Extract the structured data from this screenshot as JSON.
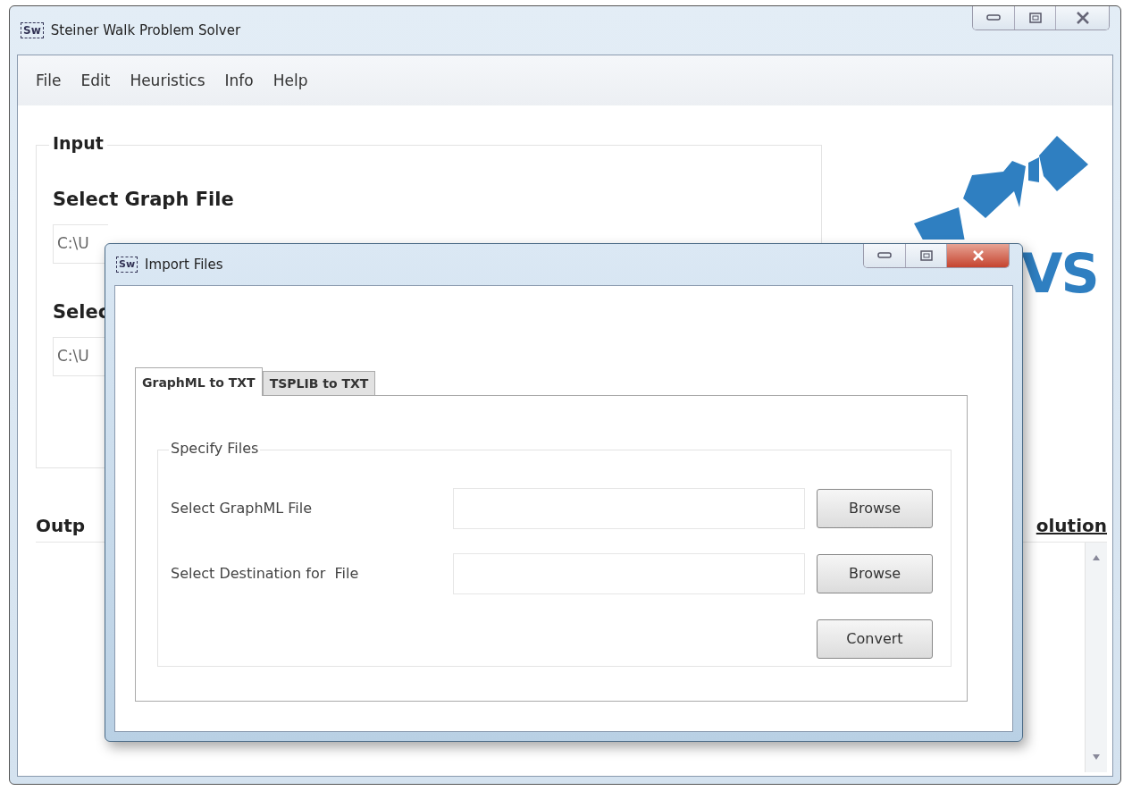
{
  "window": {
    "title": "Steiner Walk Problem Solver",
    "icon_text": "Sw"
  },
  "menu": [
    "File",
    "Edit",
    "Heuristics",
    "Info",
    "Help"
  ],
  "input_group": {
    "title": "Input",
    "graph_label": "Select Graph File",
    "graph_path": "C:\\U",
    "second_label": "Selec",
    "second_path": "C:\\U"
  },
  "logo": {
    "text": "VS"
  },
  "output": {
    "label": "Outp",
    "link": "olution"
  },
  "dialog": {
    "title": "Import Files",
    "icon_text": "Sw",
    "tabs": [
      {
        "label": "GraphML to TXT",
        "selected": true
      },
      {
        "label": "TSPLIB to TXT",
        "selected": false
      }
    ],
    "group_title": "Specify Files",
    "rows": [
      {
        "label": "Select GraphML File",
        "button": "Browse"
      },
      {
        "label": "Select Destination for  File",
        "button": "Browse"
      }
    ],
    "convert_button": "Convert"
  }
}
